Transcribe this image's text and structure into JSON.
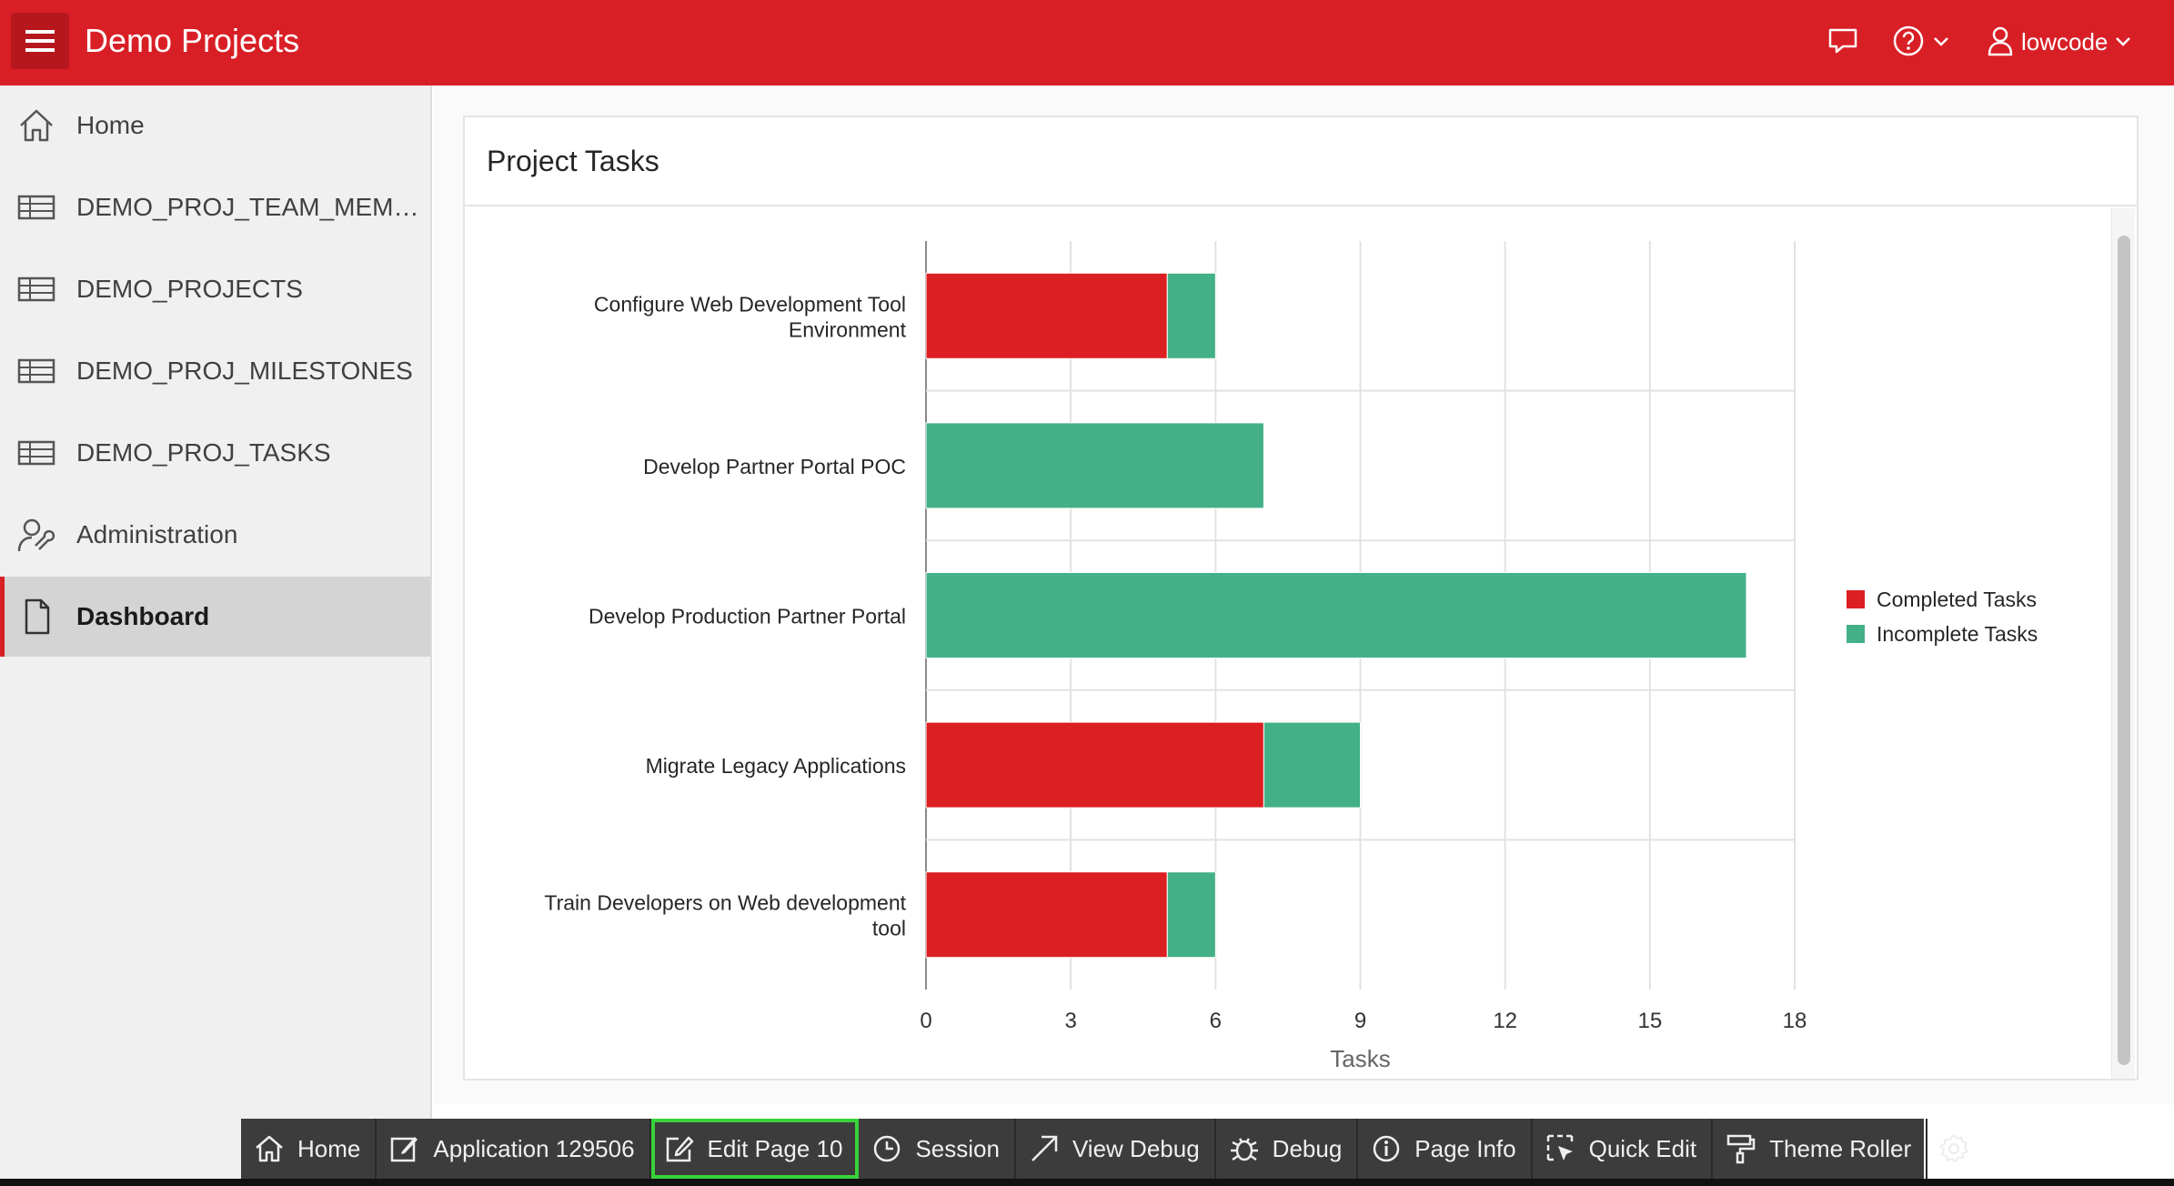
{
  "header": {
    "app_title": "Demo Projects",
    "user_name": "lowcode"
  },
  "sidebar": {
    "items": [
      {
        "label": "Home",
        "icon": "home-icon"
      },
      {
        "label": "DEMO_PROJ_TEAM_MEMBE...",
        "icon": "table-icon"
      },
      {
        "label": "DEMO_PROJECTS",
        "icon": "table-icon"
      },
      {
        "label": "DEMO_PROJ_MILESTONES",
        "icon": "table-icon"
      },
      {
        "label": "DEMO_PROJ_TASKS",
        "icon": "table-icon"
      },
      {
        "label": "Administration",
        "icon": "user-wrench-icon"
      },
      {
        "label": "Dashboard",
        "icon": "file-icon",
        "active": true
      }
    ]
  },
  "region": {
    "title": "Project Tasks"
  },
  "chart_data": {
    "type": "bar",
    "orientation": "horizontal",
    "stacked": true,
    "categories": [
      "Configure Web Development Tool Environment",
      "Develop Partner Portal POC",
      "Develop Production Partner Portal",
      "Migrate Legacy Applications",
      "Train Developers on Web development tool"
    ],
    "category_lines": [
      [
        "Configure Web Development Tool",
        "Environment"
      ],
      [
        "Develop Partner Portal POC"
      ],
      [
        "Develop Production Partner Portal"
      ],
      [
        "Migrate Legacy Applications"
      ],
      [
        "Train Developers on Web development",
        "tool"
      ]
    ],
    "series": [
      {
        "name": "Completed Tasks",
        "color": "#dc1f22",
        "values": [
          5,
          0,
          0,
          7,
          5
        ]
      },
      {
        "name": "Incomplete Tasks",
        "color": "#43b087",
        "values": [
          1,
          7,
          17,
          2,
          1
        ]
      }
    ],
    "xlabel": "Tasks",
    "xlim": [
      0,
      18
    ],
    "xticks": [
      "0",
      "3",
      "6",
      "9",
      "12",
      "15",
      "18"
    ],
    "grid": true,
    "legend": "right"
  },
  "devbar": {
    "home": "Home",
    "application": "Application 129506",
    "edit_page": "Edit Page 10",
    "session": "Session",
    "view_debug": "View Debug",
    "debug": "Debug",
    "page_info": "Page Info",
    "quick_edit": "Quick Edit",
    "theme_roller": "Theme Roller"
  }
}
